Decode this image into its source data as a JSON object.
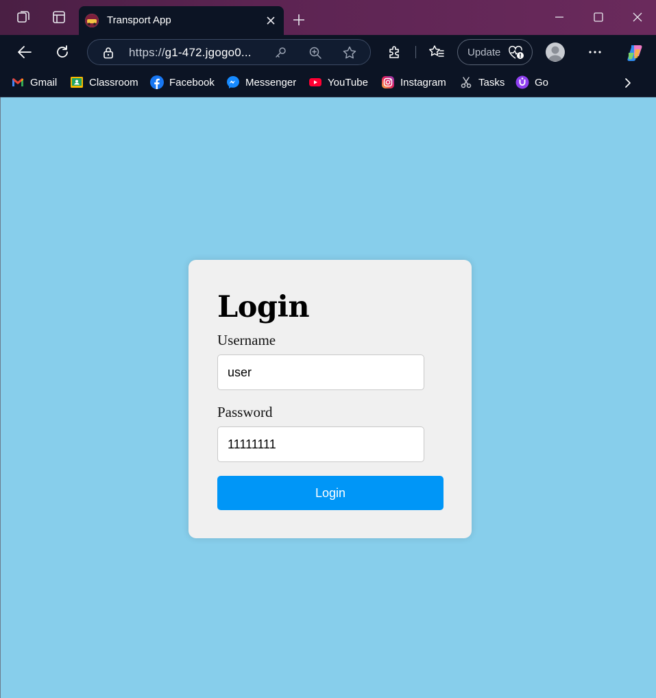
{
  "browser": {
    "tab": {
      "title": "Transport App"
    },
    "address_bar": {
      "url_scheme": "https://",
      "url_host": "g1-472.jgogo0..."
    },
    "update_label": "Update",
    "bookmarks": [
      {
        "label": "Gmail",
        "icon": "gmail-icon"
      },
      {
        "label": "Classroom",
        "icon": "classroom-icon"
      },
      {
        "label": "Facebook",
        "icon": "facebook-icon"
      },
      {
        "label": "Messenger",
        "icon": "messenger-icon"
      },
      {
        "label": "YouTube",
        "icon": "youtube-icon"
      },
      {
        "label": "Instagram",
        "icon": "instagram-icon"
      },
      {
        "label": "Tasks",
        "icon": "tasks-icon"
      },
      {
        "label": "Go",
        "icon": "go-icon"
      }
    ],
    "colors": {
      "titlebar": "#5c2452",
      "toolbar": "#0c1424"
    }
  },
  "page": {
    "background_color": "#87CEEB",
    "login": {
      "title": "Login",
      "username_label": "Username",
      "username_value": "user",
      "password_label": "Password",
      "password_value": "11111111",
      "submit_label": "Login",
      "button_color": "#0096f7",
      "card_color": "#f0f0f0"
    }
  }
}
